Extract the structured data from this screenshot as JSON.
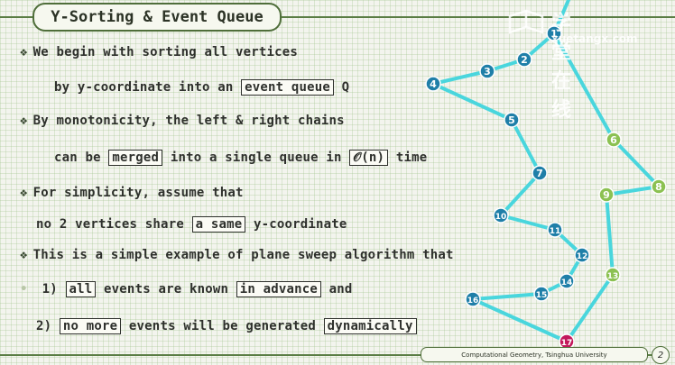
{
  "title": "Y-Sorting & Event Queue",
  "lines": [
    {
      "bullet": "❖",
      "parts": [
        {
          "text": "We begin with sorting all vertices"
        }
      ]
    },
    {
      "bullet": "",
      "parts": [
        {
          "text": "by y-coordinate into an "
        },
        {
          "text": "event queue",
          "boxed": true
        },
        {
          "text": " Q"
        }
      ]
    },
    {
      "bullet": "❖",
      "parts": [
        {
          "text": "By monotonicity, the left & right chains"
        }
      ]
    },
    {
      "bullet": "",
      "parts": [
        {
          "text": "can be "
        },
        {
          "text": "merged",
          "boxed": true
        },
        {
          "text": " into a single queue in "
        },
        {
          "text": "𝒪(n)",
          "boxed": true
        },
        {
          "text": " time"
        }
      ]
    },
    {
      "bullet": "❖",
      "parts": [
        {
          "text": "For simplicity, assume that"
        }
      ]
    },
    {
      "bullet": "",
      "parts": [
        {
          "text": "no 2 vertices share "
        },
        {
          "text": "a same",
          "boxed": true
        },
        {
          "text": " y-coordinate"
        }
      ]
    },
    {
      "bullet": "❖",
      "parts": [
        {
          "text": "This is a simple example of plane sweep algorithm that"
        }
      ]
    },
    {
      "bullet": "•",
      "parts": [
        {
          "text": "1) "
        },
        {
          "text": "all",
          "boxed": true
        },
        {
          "text": " events are known "
        },
        {
          "text": "in advance",
          "boxed": true
        },
        {
          "text": " and"
        }
      ]
    },
    {
      "bullet": "",
      "parts": [
        {
          "text": "2) "
        },
        {
          "text": "no more",
          "boxed": true
        },
        {
          "text": " events will be generated "
        },
        {
          "text": "dynamically",
          "boxed": true
        }
      ]
    }
  ],
  "vertices": [
    {
      "label": "1",
      "color": "#1f7fa8"
    },
    {
      "label": "2",
      "color": "#1f7fa8"
    },
    {
      "label": "3",
      "color": "#1f7fa8"
    },
    {
      "label": "4",
      "color": "#1f7fa8"
    },
    {
      "label": "5",
      "color": "#1f7fa8"
    },
    {
      "label": "6",
      "color": "#8cc152"
    },
    {
      "label": "7",
      "color": "#1f7fa8"
    },
    {
      "label": "8",
      "color": "#8cc152"
    },
    {
      "label": "9",
      "color": "#8cc152"
    },
    {
      "label": "10",
      "color": "#1f7fa8"
    },
    {
      "label": "11",
      "color": "#1f7fa8"
    },
    {
      "label": "12",
      "color": "#1f7fa8"
    },
    {
      "label": "13",
      "color": "#8cc152"
    },
    {
      "label": "14",
      "color": "#1f7fa8"
    },
    {
      "label": "15",
      "color": "#1f7fa8"
    },
    {
      "label": "16",
      "color": "#1f7fa8"
    },
    {
      "label": "17",
      "color": "#c2185b"
    }
  ],
  "edge_color": "#49d6dd",
  "footer": "Computational Geometry, Tsinghua University",
  "page_number": "2",
  "watermark": {
    "cn": "学堂在线",
    "url": "xuetangx.com"
  }
}
